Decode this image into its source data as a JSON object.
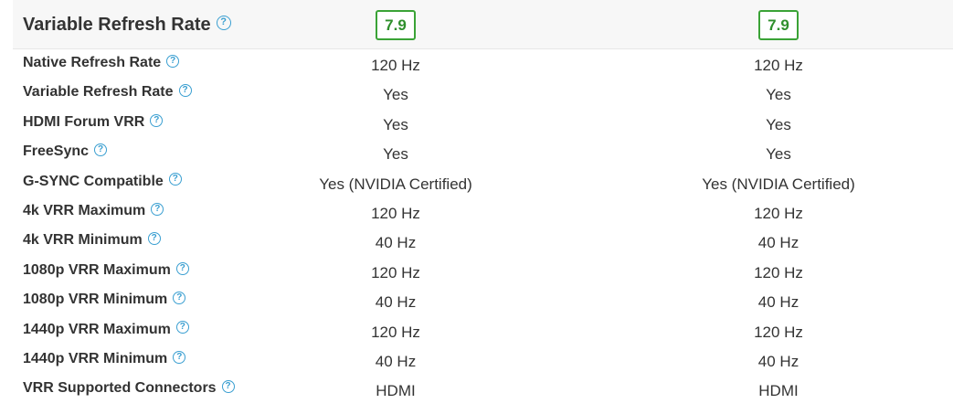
{
  "section": {
    "title": "Variable Refresh Rate",
    "help_glyph": "?",
    "scores": [
      "7.9",
      "7.9"
    ]
  },
  "rows": [
    {
      "label": "Native Refresh Rate",
      "values": [
        "120 Hz",
        "120 Hz"
      ]
    },
    {
      "label": "Variable Refresh Rate",
      "values": [
        "Yes",
        "Yes"
      ]
    },
    {
      "label": "HDMI Forum VRR",
      "values": [
        "Yes",
        "Yes"
      ]
    },
    {
      "label": "FreeSync",
      "values": [
        "Yes",
        "Yes"
      ]
    },
    {
      "label": "G-SYNC Compatible",
      "values": [
        "Yes (NVIDIA Certified)",
        "Yes (NVIDIA Certified)"
      ]
    },
    {
      "label": "4k VRR Maximum",
      "values": [
        "120 Hz",
        "120 Hz"
      ]
    },
    {
      "label": "4k VRR Minimum",
      "values": [
        "40 Hz",
        "40 Hz"
      ]
    },
    {
      "label": "1080p VRR Maximum",
      "values": [
        "120 Hz",
        "120 Hz"
      ]
    },
    {
      "label": "1080p VRR Minimum",
      "values": [
        "40 Hz",
        "40 Hz"
      ]
    },
    {
      "label": "1440p VRR Maximum",
      "values": [
        "120 Hz",
        "120 Hz"
      ]
    },
    {
      "label": "1440p VRR Minimum",
      "values": [
        "40 Hz",
        "40 Hz"
      ]
    },
    {
      "label": "VRR Supported Connectors",
      "values": [
        "HDMI",
        "HDMI"
      ]
    }
  ],
  "colors": {
    "score_border": "#3aa336",
    "score_text": "#2f8f2c",
    "help_icon": "#3a9fd1",
    "header_bg": "#f7f7f7"
  },
  "icons": {
    "help": "question-circle-icon"
  }
}
